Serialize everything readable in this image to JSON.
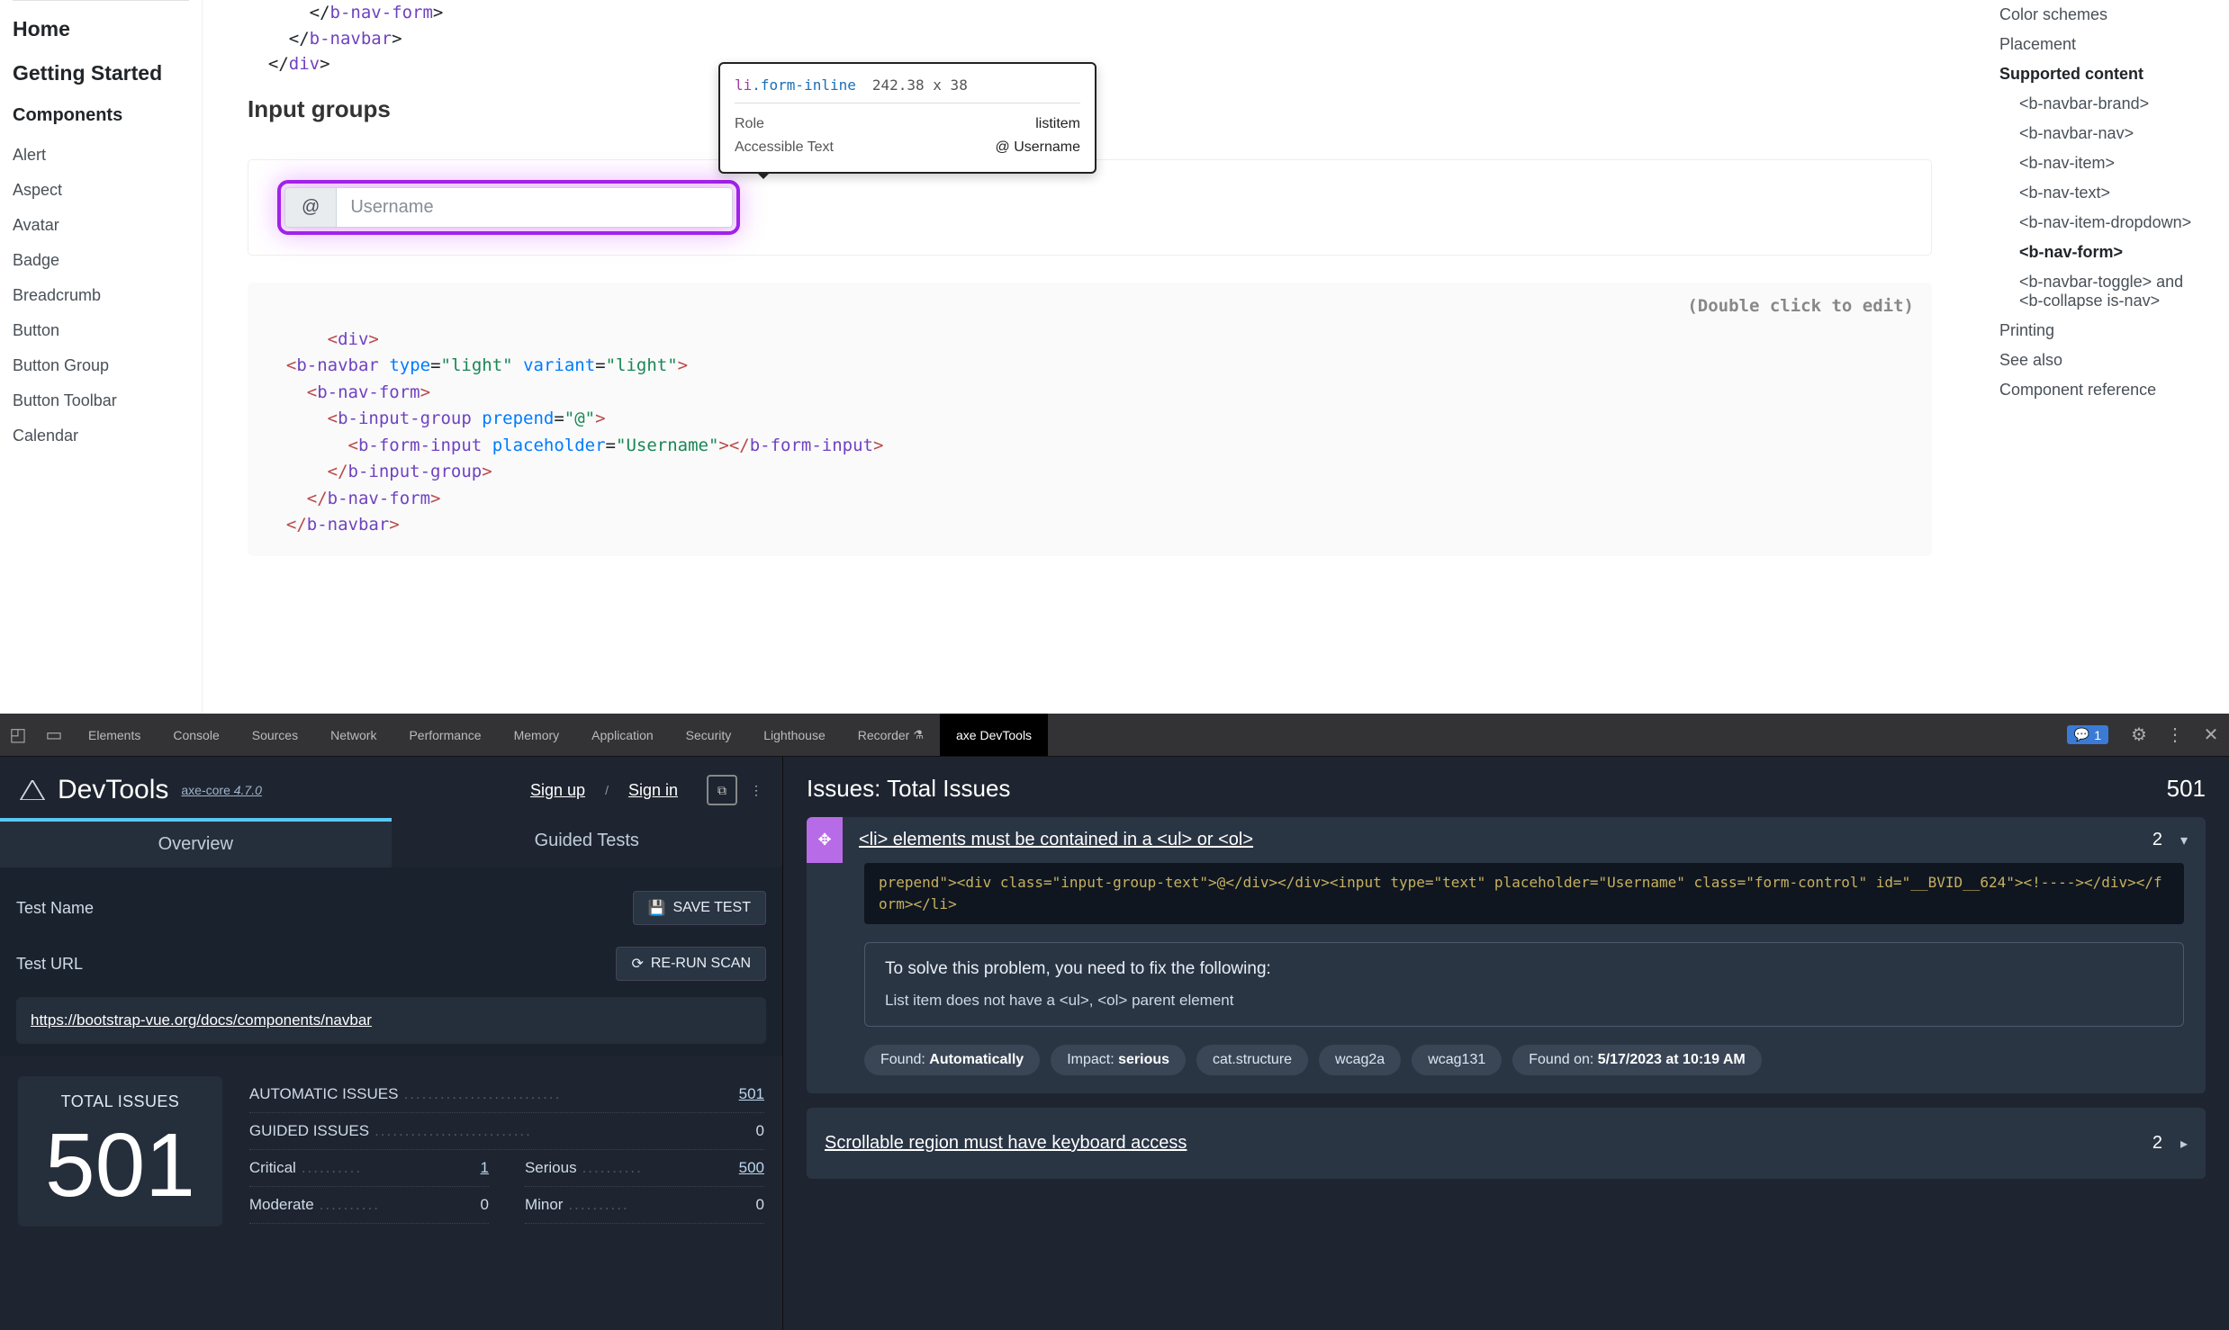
{
  "sidebar_left": {
    "links": {
      "home": "Home",
      "getting_started": "Getting Started"
    },
    "components_heading": "Components",
    "items": [
      "Alert",
      "Aspect",
      "Avatar",
      "Badge",
      "Breadcrumb",
      "Button",
      "Button Group",
      "Button Toolbar",
      "Calendar"
    ]
  },
  "main": {
    "code_top_lines": [
      "      </b-nav-form>",
      "    </b-navbar>",
      "  </div>"
    ],
    "section_heading": "Input groups",
    "tooltip": {
      "selector_el": "li",
      "selector_cls": ".form-inline",
      "dims": "242.38 x 38",
      "role_label": "Role",
      "role_value": "listitem",
      "a11y_label": "Accessible Text",
      "a11y_value": "@ Username"
    },
    "demo": {
      "prepend": "@",
      "placeholder": "Username"
    },
    "code_hint": "(Double click to edit)"
  },
  "sidebar_right": {
    "items": [
      {
        "label": "Color schemes",
        "sub": false,
        "bold": false
      },
      {
        "label": "Placement",
        "sub": false,
        "bold": false
      },
      {
        "label": "Supported content",
        "sub": false,
        "bold": true
      },
      {
        "label": "<b-navbar-brand>",
        "sub": true,
        "bold": false
      },
      {
        "label": "<b-navbar-nav>",
        "sub": true,
        "bold": false
      },
      {
        "label": "<b-nav-item>",
        "sub": true,
        "bold": false
      },
      {
        "label": "<b-nav-text>",
        "sub": true,
        "bold": false
      },
      {
        "label": "<b-nav-item-dropdown>",
        "sub": true,
        "bold": false
      },
      {
        "label": "<b-nav-form>",
        "sub": true,
        "bold": true
      },
      {
        "label": "<b-navbar-toggle> and <b-collapse is-nav>",
        "sub": true,
        "bold": false
      },
      {
        "label": "Printing",
        "sub": false,
        "bold": false
      },
      {
        "label": "See also",
        "sub": false,
        "bold": false
      },
      {
        "label": "Component reference",
        "sub": false,
        "bold": false
      }
    ]
  },
  "devtools": {
    "tabs": [
      "Elements",
      "Console",
      "Sources",
      "Network",
      "Performance",
      "Memory",
      "Application",
      "Security",
      "Lighthouse",
      "Recorder"
    ],
    "active_tab": "axe DevTools",
    "badge_count": "1",
    "brand": "DevTools",
    "axe_link": "axe-core",
    "axe_ver": "4.7.0",
    "sign_up": "Sign up",
    "sign_in": "Sign in",
    "subtabs": {
      "overview": "Overview",
      "guided": "Guided Tests"
    },
    "test_name_label": "Test Name",
    "save_test": "SAVE TEST",
    "test_url_label": "Test URL",
    "rerun": "RE-RUN SCAN",
    "test_url": "https://bootstrap-vue.org/docs/components/navbar",
    "total_label": "TOTAL ISSUES",
    "total_num": "501",
    "breakdown": {
      "automatic": {
        "label": "AUTOMATIC ISSUES",
        "num": "501",
        "link": true
      },
      "guided": {
        "label": "GUIDED ISSUES",
        "num": "0",
        "link": false
      },
      "critical": {
        "label": "Critical",
        "num": "1",
        "link": true
      },
      "serious": {
        "label": "Serious",
        "num": "500",
        "link": true
      },
      "moderate": {
        "label": "Moderate",
        "num": "0",
        "link": false
      },
      "minor": {
        "label": "Minor",
        "num": "0",
        "link": false
      }
    },
    "issues_title": "Issues: Total Issues",
    "issues_total": "501",
    "issue1": {
      "title": "<li> elements must be contained in a <ul> or <ol>",
      "count": "2",
      "code": "prepend\"><div class=\"input-group-text\">@</div></div><input type=\"text\" placeholder=\"Username\" class=\"form-control\" id=\"__BVID__624\"><!----></div></form></li>",
      "fix_title": "To solve this problem, you need to fix the following:",
      "fix_detail": "List item does not have a <ul>, <ol> parent element",
      "pills": {
        "found_label": "Found: ",
        "found_val": "Automatically",
        "impact_label": "Impact: ",
        "impact_val": "serious",
        "cat": "cat.structure",
        "wcag2a": "wcag2a",
        "wcag131": "wcag131",
        "foundon_label": "Found on: ",
        "foundon_val": "5/17/2023 at 10:19 AM"
      }
    },
    "issue2": {
      "title": "Scrollable region must have keyboard access",
      "count": "2"
    }
  }
}
